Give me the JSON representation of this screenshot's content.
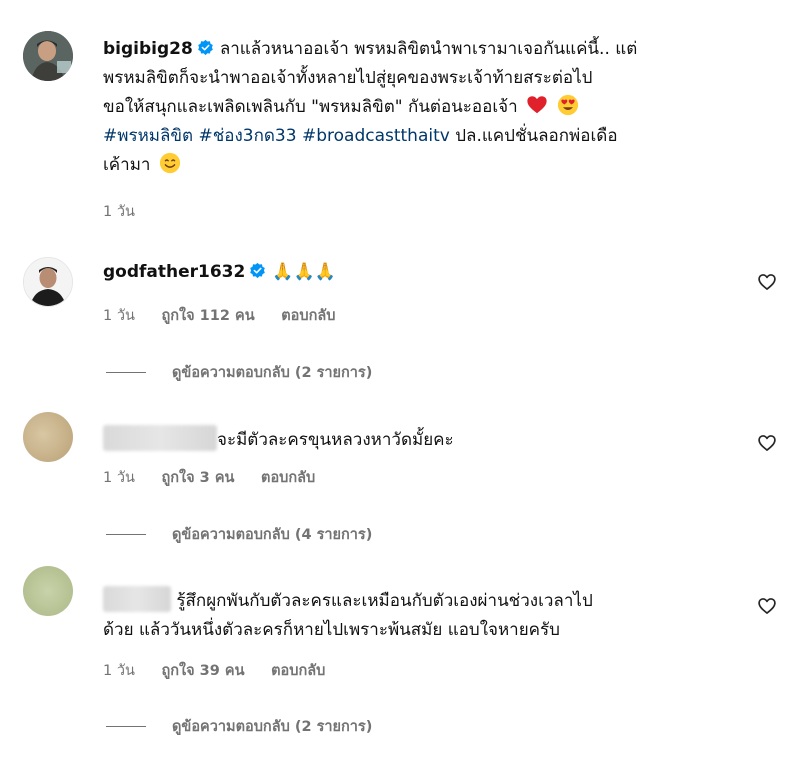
{
  "post": {
    "username": "bigibig28",
    "caption_line1": "ลาแล้วหนาออเจ้า พรหมลิขิตนำพาเรามาเจอกันแค่นี้.. แต่",
    "caption_line2": "พรหมลิขิตก็จะนำพาออเจ้าทั้งหลายไปสู่ยุคของพระเจ้าท้ายสระต่อไป",
    "caption_line3": "ขอให้สนุกและเพลิดเพลินกับ \"พรหมลิขิต\" กันต่อนะออเจ้า",
    "hashtags": [
      "#พรหมลิขิต",
      "#ช่อง3กด33",
      "#broadcastthaitv"
    ],
    "caption_tail": "ปล.แคปชั่นลอกพ่อเดือ",
    "caption_line5": "เค้ามา",
    "time": "1 วัน"
  },
  "comments": [
    {
      "username": "godfather1632",
      "text": "🙏🙏🙏",
      "time": "1 วัน",
      "likes": "ถูกใจ 112 คน",
      "reply_label": "ตอบกลับ",
      "view_replies": "ดูข้อความตอบกลับ (2 รายการ)"
    },
    {
      "text": "จะมีตัวละครขุนหลวงหาวัดมั้ยคะ",
      "time": "1 วัน",
      "likes": "ถูกใจ 3 คน",
      "reply_label": "ตอบกลับ",
      "view_replies": "ดูข้อความตอบกลับ (4 รายการ)"
    },
    {
      "text_line1": "รู้สึกผูกพันกับตัวละครและเหมือนกับตัวเองผ่านช่วงเวลาไป",
      "text_line2": "ด้วย แล้ววันหนึ่งตัวละครก็หายไปเพราะพ้นสมัย แอบใจหายครับ",
      "time": "1 วัน",
      "likes": "ถูกใจ 39 คน",
      "reply_label": "ตอบกลับ",
      "view_replies": "ดูข้อความตอบกลับ (2 รายการ)"
    }
  ],
  "icons": {
    "verified": "verified-badge-icon",
    "like": "heart-outline-icon",
    "emojis": [
      "red-heart-emoji",
      "heart-eyes-emoji",
      "smiling-face-emoji",
      "folded-hands-emoji"
    ]
  },
  "colors": {
    "hashtag": "#00376b",
    "muted": "#737373",
    "verified": "#0095f6"
  }
}
